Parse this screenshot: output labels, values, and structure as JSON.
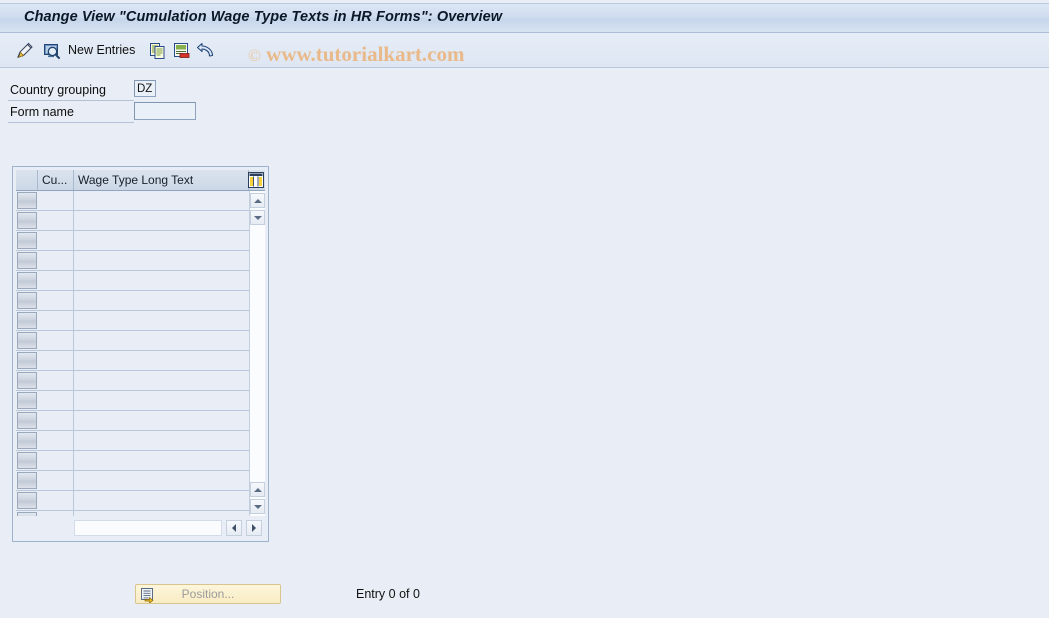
{
  "window": {
    "title": "Change View \"Cumulation Wage Type Texts in HR Forms\": Overview"
  },
  "toolbar": {
    "display_change_icon": "pencil-display-change-icon",
    "check_icon": "magnifier-screen-icon",
    "new_entries_label": "New Entries",
    "copy_icon": "copy-icon",
    "paste_icon": "paste-icon",
    "undo_icon": "undo-icon",
    "watermark": "www.tutorialkart.com",
    "watermark_mark": "©"
  },
  "form": {
    "country_grouping_label": "Country grouping",
    "country_grouping_value": "DZ",
    "form_name_label": "Form name",
    "form_name_value": "",
    "form_name_placeholder": ""
  },
  "table": {
    "columns": [
      {
        "key": "select",
        "label": ""
      },
      {
        "key": "cu",
        "label": "Cu..."
      },
      {
        "key": "wage_type_long_text",
        "label": "Wage Type Long Text"
      }
    ],
    "rows": [],
    "empty_row_count": 17,
    "config_icon": "column-config-icon",
    "scroll_up_icon": "scroll-up-arrow-icon",
    "scroll_down_icon": "scroll-down-arrow-icon",
    "scroll_left_icon": "scroll-left-arrow-icon",
    "scroll_right_icon": "scroll-right-arrow-icon"
  },
  "footer": {
    "position_label": "Position...",
    "position_icon": "position-list-icon",
    "entry_status": "Entry 0 of 0"
  },
  "colors": {
    "background": "#e9eef6",
    "title_bar": "#cfdcee",
    "accent_border": "#9db3cd",
    "watermark": "#e9b98a",
    "button_yellow": "#f8ecc2"
  }
}
